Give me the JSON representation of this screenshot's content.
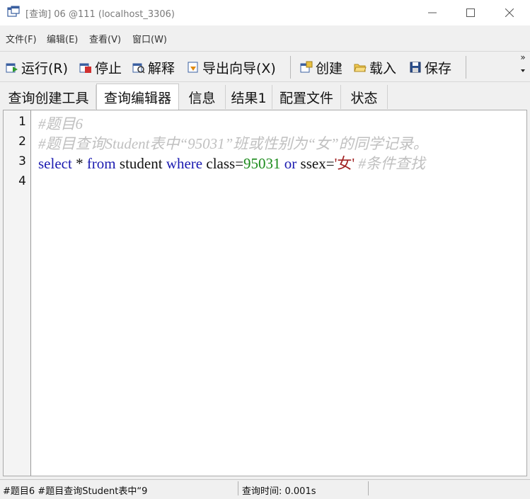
{
  "window": {
    "title": "[查询] 06 @111 (localhost_3306)",
    "icon": "query-window-icon"
  },
  "menu": {
    "items": [
      "文件(F)",
      "编辑(E)",
      "查看(V)",
      "窗口(W)"
    ]
  },
  "toolbar": {
    "run_label": "运行(R)",
    "stop_label": "停止",
    "explain_label": "解释",
    "export_label": "导出向导(X)",
    "create_label": "创建",
    "load_label": "载入",
    "save_label": "保存",
    "more_glyph": "»"
  },
  "tabs": [
    {
      "label": "查询创建工具"
    },
    {
      "label": "查询编辑器",
      "active": true
    },
    {
      "label": "信息"
    },
    {
      "label": "结果1"
    },
    {
      "label": "配置文件"
    },
    {
      "label": "状态"
    }
  ],
  "editor": {
    "line_numbers": [
      "1",
      "2",
      "3",
      "4"
    ],
    "line1": "#题目6",
    "line2": "#题目查询Student表中“95031”班或性别为“女”的同学记录。",
    "line3": {
      "kw_select": "select",
      "star": " * ",
      "kw_from": "from",
      "table": " student ",
      "kw_where": "where",
      "col_class": " class=",
      "num": "95031",
      "space1": " ",
      "kw_or": "or",
      "col_ssex": " ssex=",
      "str": "'女'",
      "comment": " #条件查找"
    }
  },
  "status": {
    "left": "#题目6 #题目查询Student表中“9",
    "query_time": "查询时间: 0.001s"
  },
  "colors": {
    "keyword": "#1a1ab0",
    "number": "#1a8a1a",
    "string": "#a02020",
    "comment": "#c0c0c0"
  }
}
